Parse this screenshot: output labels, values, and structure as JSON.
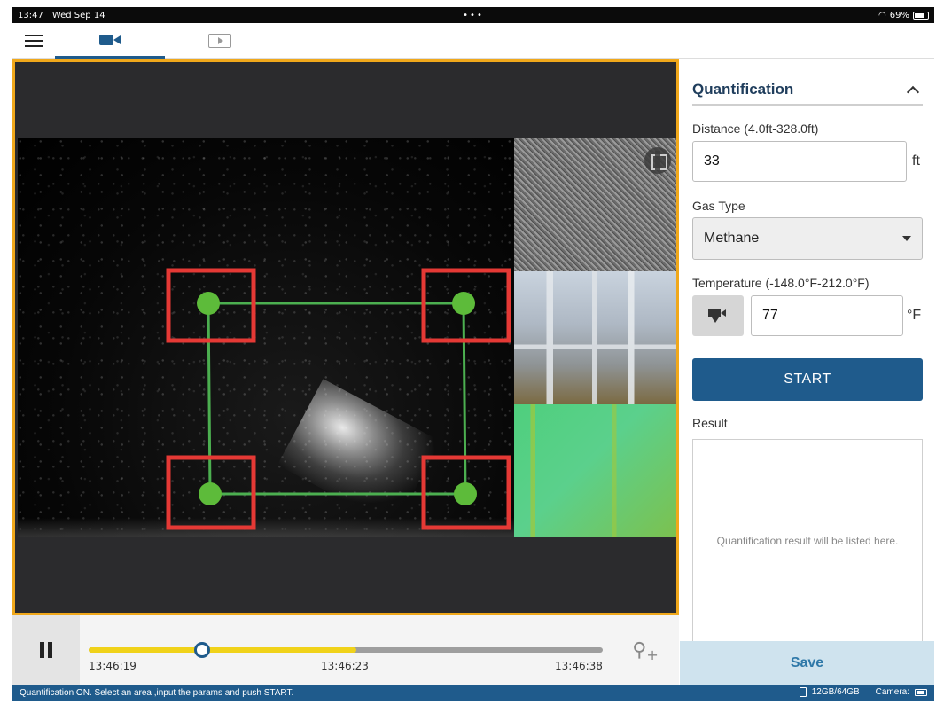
{
  "status": {
    "time": "13:47",
    "date": "Wed Sep 14",
    "dots": "•••",
    "battery": "69%",
    "wifi_icon": "wifi-icon"
  },
  "nav": {
    "tabs": [
      {
        "name": "live",
        "icon": "video-camera-icon",
        "active": true
      },
      {
        "name": "playback",
        "icon": "play-icon",
        "active": false
      }
    ]
  },
  "playback": {
    "time_start": "13:46:19",
    "time_mid": "13:46:23",
    "time_end": "13:46:38",
    "progress": 0.22,
    "buffered": 0.52
  },
  "panel": {
    "title": "Quantification",
    "distance_label": "Distance (4.0ft-328.0ft)",
    "distance_value": "33",
    "distance_unit": "ft",
    "gas_label": "Gas Type",
    "gas_value": "Methane",
    "temp_label": "Temperature (-148.0°F-212.0°F)",
    "temp_value": "77",
    "temp_unit": "°F",
    "start_label": "START",
    "result_label": "Result",
    "result_placeholder": "Quantification result will be listed here."
  },
  "save_label": "Save",
  "footer": {
    "message": "Quantification ON. Select an area ,input the params and push START.",
    "storage": "12GB/64GB",
    "camera_label": "Camera:"
  },
  "colors": {
    "accent": "#1f5b8c",
    "frame": "#f0a81b",
    "roi_line": "#4caf50",
    "roi_box": "#e53935"
  }
}
